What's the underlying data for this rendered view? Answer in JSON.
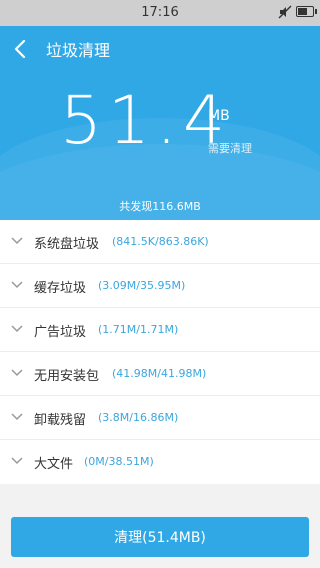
{
  "status_bar": {
    "time": "17:16"
  },
  "header": {
    "title": "垃圾清理"
  },
  "summary": {
    "size_value": "51.4",
    "size_unit": "MB",
    "need_clean_label": "需要清理",
    "found_total": "共发现116.6MB"
  },
  "items": [
    {
      "name": "系统盘垃圾",
      "size": "(841.5K/863.86K)"
    },
    {
      "name": "缓存垃圾",
      "size": "(3.09M/35.95M)"
    },
    {
      "name": "广告垃圾",
      "size": "(1.71M/1.71M)"
    },
    {
      "name": "无用安装包",
      "size": "(41.98M/41.98M)"
    },
    {
      "name": "卸载残留",
      "size": "(3.8M/16.86M)"
    },
    {
      "name": "大文件",
      "size": "(0M/38.51M)"
    }
  ],
  "clean_button": {
    "label": "清理(51.4MB)"
  },
  "colors": {
    "accent": "#30a8e6",
    "size_text": "#3aa6e0"
  }
}
